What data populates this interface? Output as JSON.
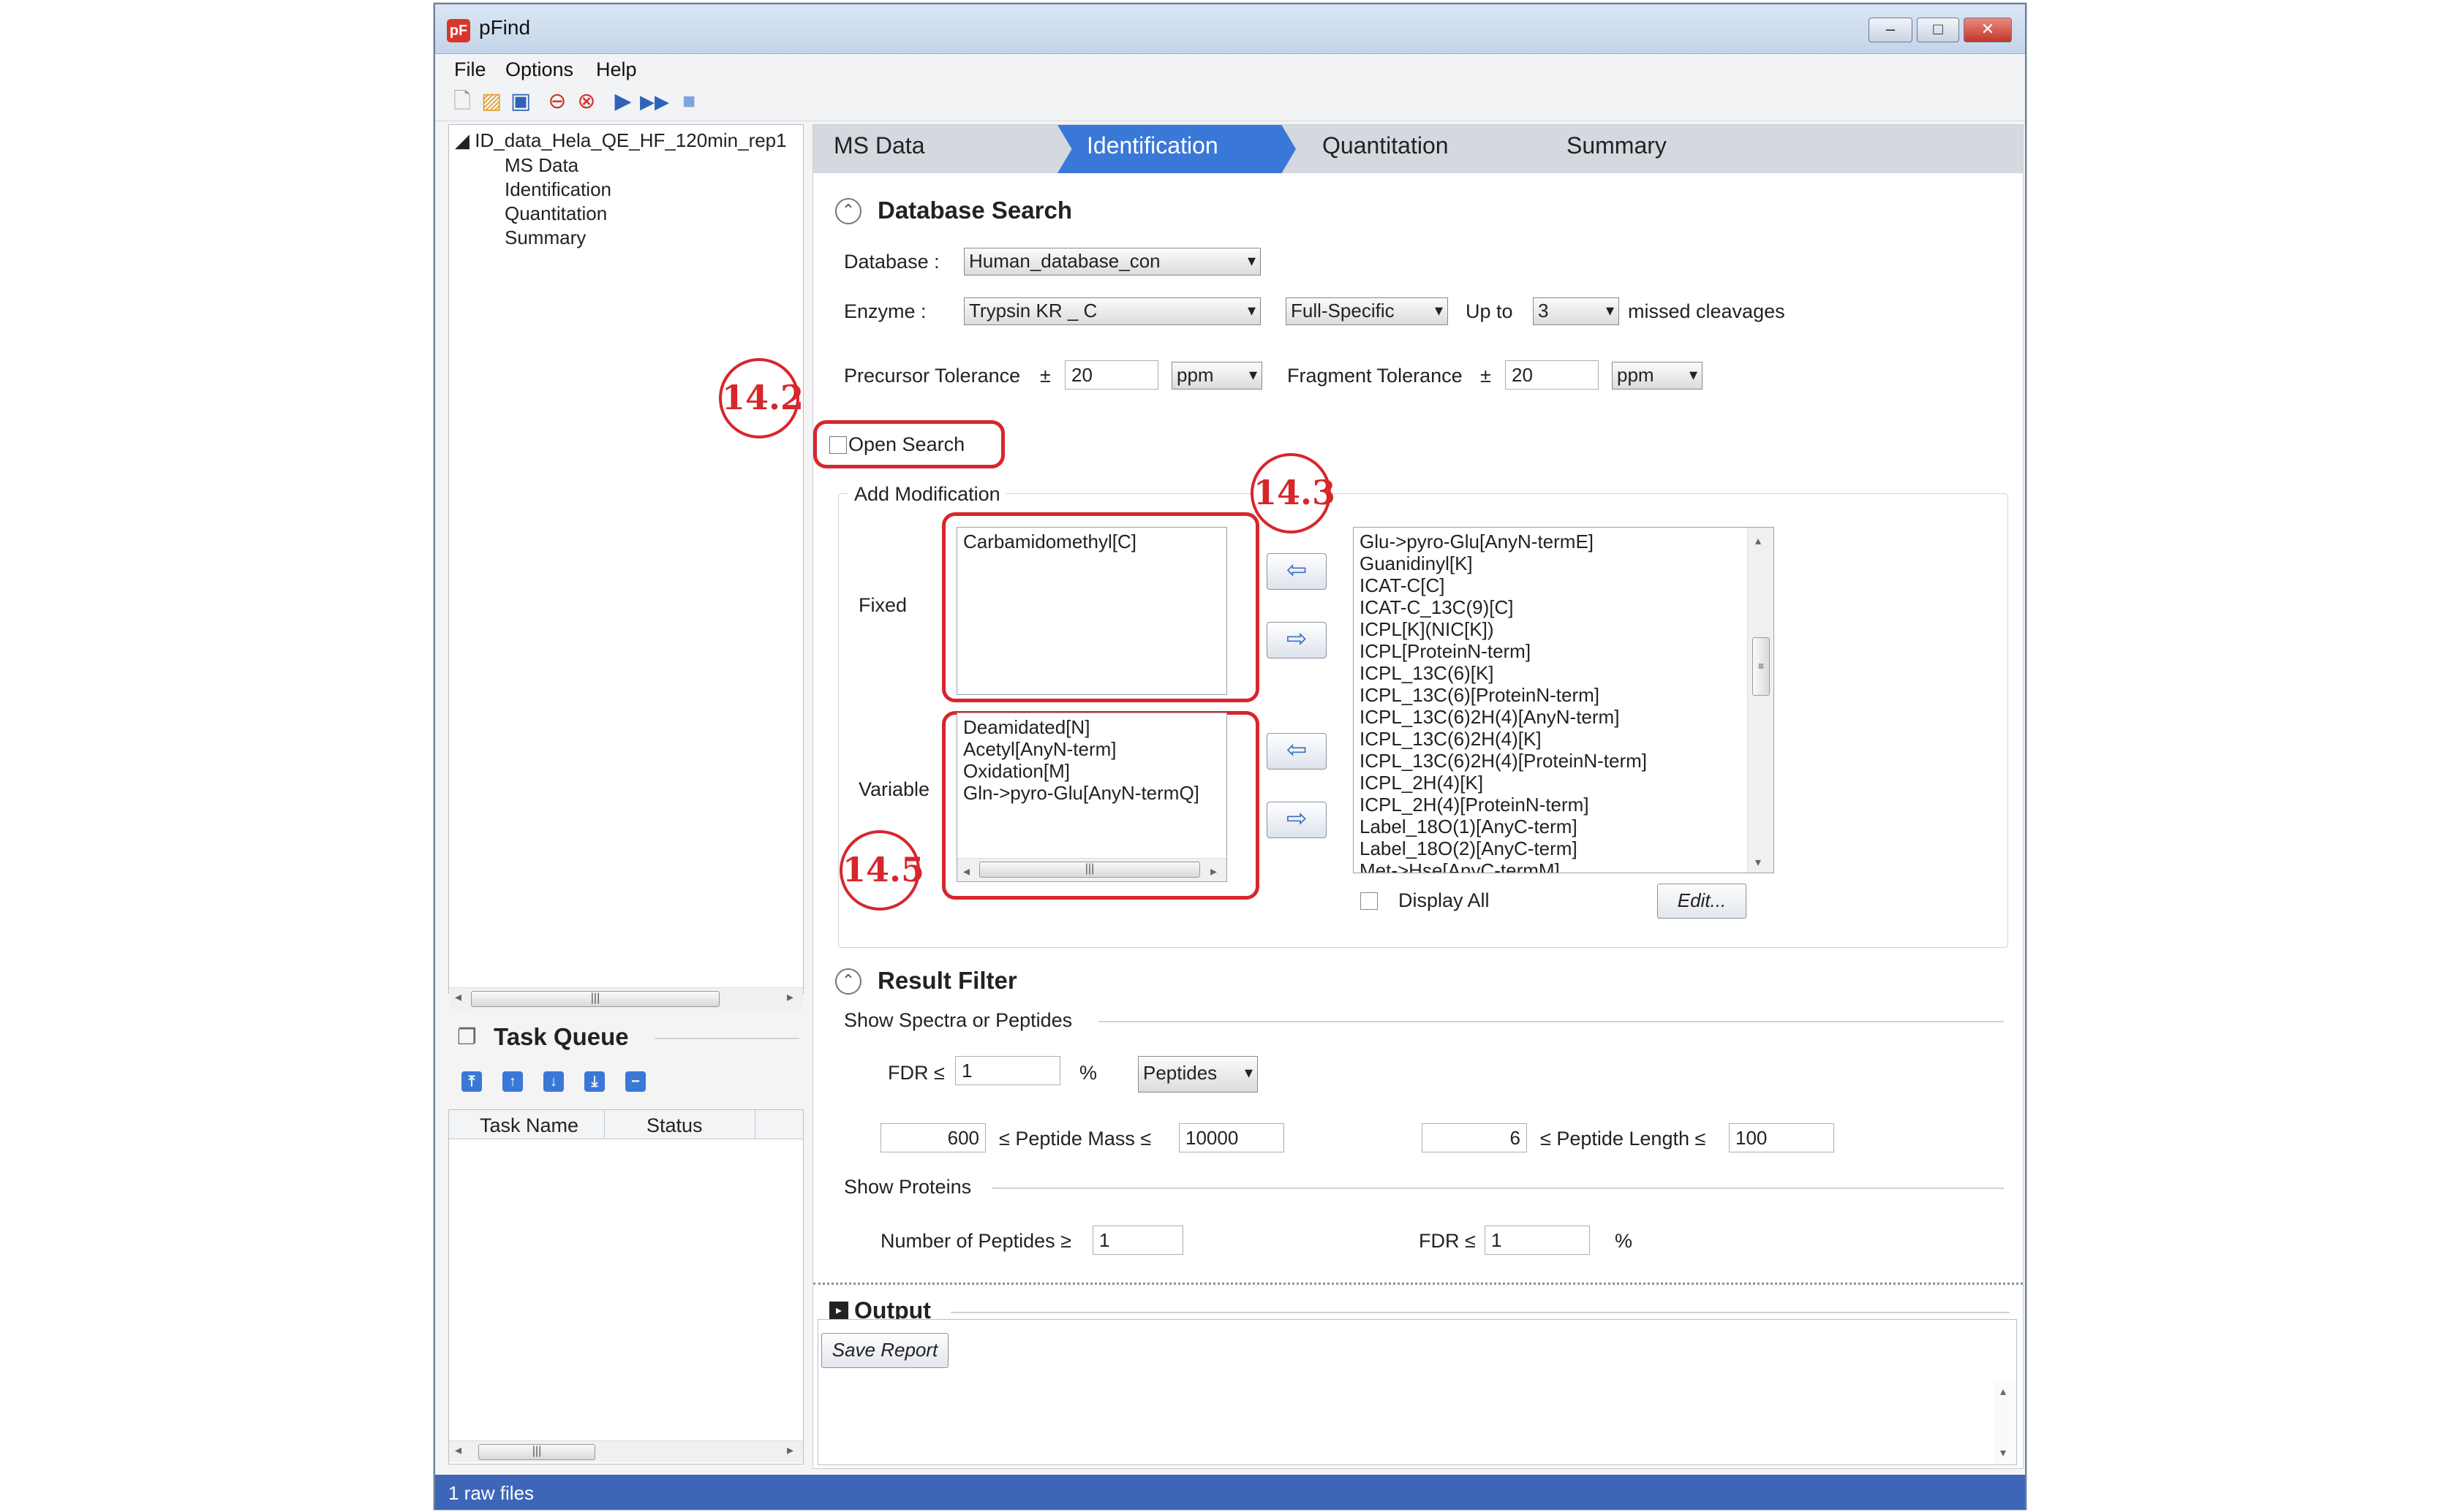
{
  "window": {
    "title": "pFind",
    "app_icon": "pF",
    "minimize": "–",
    "maximize": "□",
    "close": "✕"
  },
  "menu": [
    "File",
    "Options",
    "Help"
  ],
  "toolbar_icons": [
    "new-file-icon",
    "open-folder-icon",
    "save-icon",
    "stop-icon",
    "cancel-icon",
    "run-icon",
    "run-all-icon",
    "stop-square-icon"
  ],
  "tree": {
    "root": "ID_data_Hela_QE_HF_120min_rep1",
    "items": [
      "MS Data",
      "Identification",
      "Quantitation",
      "Summary"
    ]
  },
  "task_queue": {
    "title": "Task Queue",
    "columns": [
      "Task Name",
      "Status"
    ]
  },
  "tabs": [
    "MS Data",
    "Identification",
    "Quantitation",
    "Summary"
  ],
  "database_search": {
    "title": "Database Search",
    "database_label": "Database :",
    "database_value": "Human_database_con",
    "enzyme_label": "Enzyme :",
    "enzyme_value": "Trypsin KR _ C",
    "specificity": "Full-Specific",
    "upto_label": "Up to",
    "missed_value": "3",
    "missed_label": "missed cleavages",
    "precursor_label": "Precursor Tolerance",
    "pm1": "±",
    "precursor_value": "20",
    "precursor_unit": "ppm",
    "fragment_label": "Fragment Tolerance",
    "pm2": "±",
    "fragment_value": "20",
    "fragment_unit": "ppm",
    "open_search_label": "Open Search"
  },
  "add_modification": {
    "title": "Add Modification",
    "fixed_label": "Fixed",
    "variable_label": "Variable",
    "fixed_items": [
      "Carbamidomethyl[C]"
    ],
    "variable_items": [
      "Deamidated[N]",
      "Acetyl[AnyN-term]",
      "Oxidation[M]",
      "Gln->pyro-Glu[AnyN-termQ]"
    ],
    "available_items": [
      "Glu->pyro-Glu[AnyN-termE]",
      "Guanidinyl[K]",
      "ICAT-C[C]",
      "ICAT-C_13C(9)[C]",
      "ICPL[K](NIC[K])",
      "ICPL[ProteinN-term]",
      "ICPL_13C(6)[K]",
      "ICPL_13C(6)[ProteinN-term]",
      "ICPL_13C(6)2H(4)[AnyN-term]",
      "ICPL_13C(6)2H(4)[K]",
      "ICPL_13C(6)2H(4)[ProteinN-term]",
      "ICPL_2H(4)[K]",
      "ICPL_2H(4)[ProteinN-term]",
      "Label_18O(1)[AnyC-term]",
      "Label_18O(2)[AnyC-term]",
      "Met->Hse[AnyC-termM]"
    ],
    "display_all_label": "Display All",
    "edit_button": "Edit...",
    "arrow_left": "⇦",
    "arrow_right": "⇨"
  },
  "result_filter": {
    "title": "Result Filter",
    "spectra_label": "Show Spectra or Peptides",
    "fdr_label": "FDR ≤",
    "fdr_value": "1",
    "percent": "%",
    "level": "Peptides",
    "mass_min": "600",
    "mass_label": "≤ Peptide Mass ≤",
    "mass_max": "10000",
    "len_min": "6",
    "len_label": "≤ Peptide Length ≤",
    "len_max": "100",
    "proteins_label": "Show Proteins",
    "num_peptides_label": "Number of Peptides ≥",
    "num_peptides_value": "1",
    "protein_fdr_label": "FDR ≤",
    "protein_fdr_value": "1",
    "protein_percent": "%"
  },
  "output": {
    "title": "Output",
    "save_report": "Save Report"
  },
  "status": {
    "text": "1 raw files"
  },
  "callouts": [
    "14.2",
    "14.3",
    "14.5"
  ],
  "colors": {
    "accent": "#3a78d8",
    "annotation": "#d7262c",
    "status_bar": "#3d66b8",
    "active_tab": "#3a78d8"
  }
}
